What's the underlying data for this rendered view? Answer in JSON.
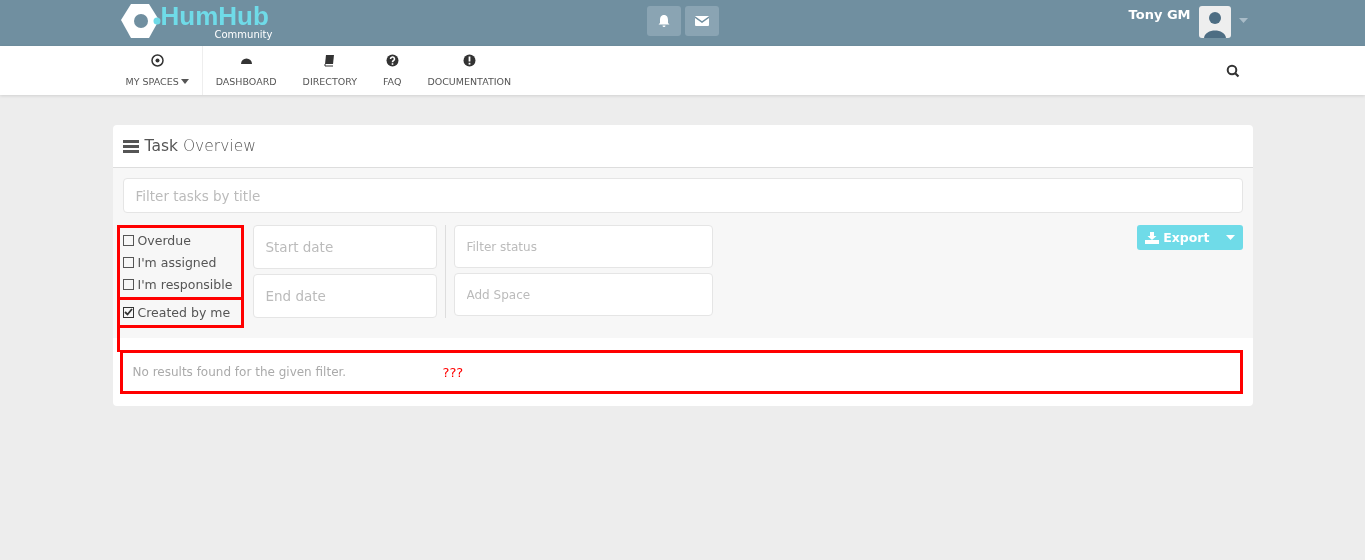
{
  "topbar": {
    "logo": {
      "text": "HumHub",
      "subtitle": "Community"
    },
    "user": {
      "name": "Tony GM"
    }
  },
  "nav": {
    "items": [
      {
        "label": "MY SPACES",
        "kind": "dropdown"
      },
      {
        "label": "DASHBOARD",
        "kind": "link"
      },
      {
        "label": "DIRECTORY",
        "kind": "link"
      },
      {
        "label": "FAQ",
        "kind": "link"
      },
      {
        "label": "DOCUMENTATION",
        "kind": "link"
      }
    ]
  },
  "panel": {
    "title_bold": "Task",
    "title_rest": "Overview",
    "search": {
      "placeholder": "Filter tasks by title"
    },
    "checkboxes": [
      {
        "label": "Overdue",
        "checked": false
      },
      {
        "label": "I'm assigned",
        "checked": false
      },
      {
        "label": "I'm responsible",
        "checked": false
      },
      {
        "label": "Created by me",
        "checked": true
      }
    ],
    "date_fields": [
      {
        "placeholder": "Start date"
      },
      {
        "placeholder": "End date"
      }
    ],
    "select_fields": [
      {
        "placeholder": "Filter status"
      },
      {
        "placeholder": "Add Space"
      }
    ],
    "export_button": "Export",
    "empty_message": "No results found for the given filter.",
    "annotation_note": "???"
  }
}
